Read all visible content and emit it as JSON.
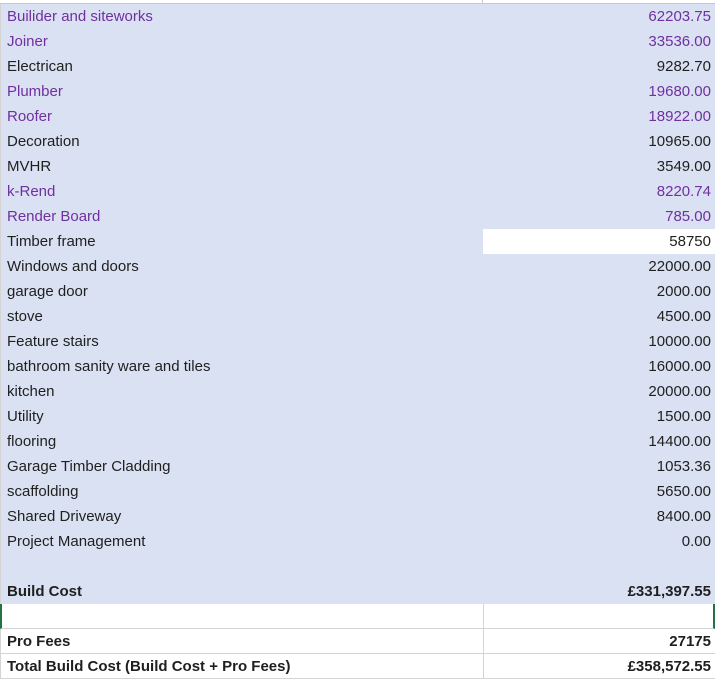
{
  "items": [
    {
      "label": "Builider and siteworks",
      "value": "62203.75",
      "purple": true
    },
    {
      "label": "Joiner",
      "value": "33536.00",
      "purple": true
    },
    {
      "label": "Electrican",
      "value": "9282.70",
      "purple": false
    },
    {
      "label": "Plumber",
      "value": "19680.00",
      "purple": true
    },
    {
      "label": "Roofer",
      "value": "18922.00",
      "purple": true
    },
    {
      "label": "Decoration",
      "value": "10965.00",
      "purple": false
    },
    {
      "label": "MVHR",
      "value": "3549.00",
      "purple": false
    },
    {
      "label": "k-Rend",
      "value": "8220.74",
      "purple": true
    },
    {
      "label": "Render Board",
      "value": "785.00",
      "purple": true
    },
    {
      "label": "Timber frame",
      "value": "58750",
      "purple": false,
      "white_value": true
    },
    {
      "label": "Windows and doors",
      "value": "22000.00",
      "purple": false
    },
    {
      "label": "garage door",
      "value": "2000.00",
      "purple": false
    },
    {
      "label": "stove",
      "value": "4500.00",
      "purple": false
    },
    {
      "label": "Feature stairs",
      "value": "10000.00",
      "purple": false
    },
    {
      "label": "bathroom sanity ware and tiles",
      "value": "16000.00",
      "purple": false
    },
    {
      "label": "kitchen",
      "value": "20000.00",
      "purple": false
    },
    {
      "label": "Utility",
      "value": "1500.00",
      "purple": false
    },
    {
      "label": "flooring",
      "value": "14400.00",
      "purple": false
    },
    {
      "label": "Garage Timber Cladding",
      "value": "1053.36",
      "purple": false
    },
    {
      "label": "scaffolding",
      "value": "5650.00",
      "purple": false
    },
    {
      "label": "Shared Driveway",
      "value": "8400.00",
      "purple": false
    },
    {
      "label": "Project Management",
      "value": "0.00",
      "purple": false
    }
  ],
  "build_cost": {
    "label": "Build Cost",
    "value": "£331,397.55"
  },
  "pro_fees": {
    "label": "Pro Fees",
    "value": "27175"
  },
  "total_build_cost": {
    "label": "Total Build Cost (Build Cost + Pro Fees)",
    "value": "£358,572.55"
  },
  "colors": {
    "shade": "#d9e1f2",
    "purple_text": "#7030a0",
    "selection_border": "#217346"
  }
}
